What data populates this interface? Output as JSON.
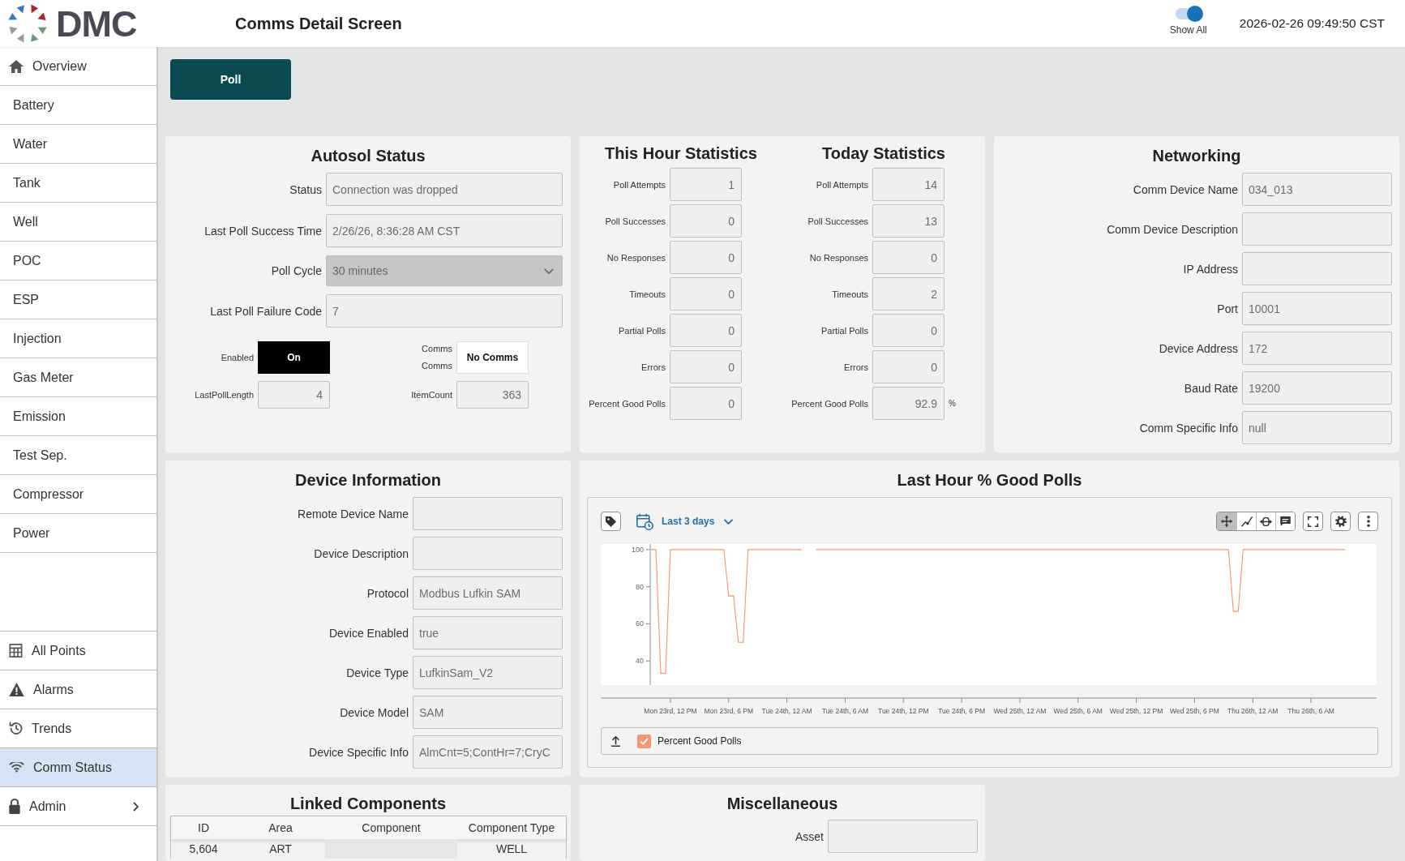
{
  "header": {
    "logo": "DMC",
    "title": "Comms Detail Screen",
    "show_all": {
      "label": "Show All",
      "on": true
    },
    "timestamp": "2026-02-26 09:49:50 CST"
  },
  "sidebar": {
    "items": [
      {
        "label": "Overview",
        "selected": false
      },
      {
        "label": "Battery",
        "selected": false
      },
      {
        "label": "Water",
        "selected": false
      },
      {
        "label": "Tank",
        "selected": false
      },
      {
        "label": "Well",
        "selected": false
      },
      {
        "label": "POC",
        "selected": false
      },
      {
        "label": "ESP",
        "selected": false
      },
      {
        "label": "Injection",
        "selected": false
      },
      {
        "label": "Gas Meter",
        "selected": false
      },
      {
        "label": "Emission",
        "selected": false
      },
      {
        "label": "Test Sep.",
        "selected": false
      },
      {
        "label": "Compressor",
        "selected": false
      },
      {
        "label": "Power",
        "selected": false
      }
    ],
    "bottom_items": [
      {
        "label": "All Points",
        "selected": false,
        "kind": "link"
      },
      {
        "label": "Alarms",
        "selected": false,
        "kind": "link"
      },
      {
        "label": "Trends",
        "selected": false,
        "kind": "link"
      },
      {
        "label": "Comm Status",
        "selected": true,
        "kind": "link"
      },
      {
        "label": "Admin",
        "selected": false,
        "kind": "group"
      }
    ]
  },
  "toolbar": {
    "poll_button": "Poll"
  },
  "autosol_status": {
    "title": "Autosol Status",
    "fields": [
      {
        "label": "Status",
        "value": "Connection was dropped",
        "kind": "text"
      },
      {
        "label": "Last Poll Success Time",
        "value": "2/26/26, 8:36:28 AM CST",
        "kind": "text"
      },
      {
        "label": "Poll Cycle",
        "value": "30 minutes",
        "kind": "select"
      },
      {
        "label": "Last Poll Failure Code",
        "value": "7",
        "kind": "text"
      }
    ],
    "indicators": [
      {
        "label": [
          "Enabled"
        ],
        "value": "On",
        "on": true
      },
      {
        "label": [
          "Comms",
          "Comms"
        ],
        "value": "No Comms",
        "on": false
      }
    ],
    "counters": [
      {
        "label": "LastPollLength",
        "value": "4"
      },
      {
        "label": "ItemCount",
        "value": "363"
      }
    ]
  },
  "statistics": [
    {
      "title": "This Hour Statistics",
      "rows": [
        {
          "label": "Poll Attempts",
          "value": "1"
        },
        {
          "label": "Poll Successes",
          "value": "0"
        },
        {
          "label": "No Responses",
          "value": "0"
        },
        {
          "label": "Timeouts",
          "value": "0"
        },
        {
          "label": "Partial Polls",
          "value": "0"
        },
        {
          "label": "Errors",
          "value": "0"
        },
        {
          "label": "Percent Good Polls",
          "value": "0"
        }
      ]
    },
    {
      "title": "Today Statistics",
      "rows": [
        {
          "label": "Poll Attempts",
          "value": "14"
        },
        {
          "label": "Poll Successes",
          "value": "13"
        },
        {
          "label": "No Responses",
          "value": "0"
        },
        {
          "label": "Timeouts",
          "value": "2"
        },
        {
          "label": "Partial Polls",
          "value": "0"
        },
        {
          "label": "Errors",
          "value": "0"
        },
        {
          "label": "Percent Good Polls",
          "value": "92.9",
          "unit": "%"
        }
      ]
    }
  ],
  "networking": {
    "title": "Networking",
    "fields": [
      {
        "label": "Comm Device Name",
        "value": "034_013"
      },
      {
        "label": "Comm Device Description"
      },
      {
        "label": "IP Address"
      },
      {
        "label": "Port",
        "value": "10001"
      },
      {
        "label": "Device Address",
        "value": "172"
      },
      {
        "label": "Baud Rate",
        "value": "19200"
      },
      {
        "label": "Comm Specific Info",
        "value": "null"
      }
    ]
  },
  "device_information": {
    "title": "Device Information",
    "fields": [
      {
        "label": "Remote Device Name"
      },
      {
        "label": "Device Description"
      },
      {
        "label": "Protocol",
        "value": "Modbus Lufkin SAM"
      },
      {
        "label": "Device Enabled",
        "value": "true"
      },
      {
        "label": "Device Type",
        "value": "LufkinSam_V2"
      },
      {
        "label": "Device Model",
        "value": "SAM"
      },
      {
        "label": "Device Specific Info",
        "value": "AlmCnt=5;ContHr=7;CryC"
      }
    ]
  },
  "chart_panel": {
    "title": "Last Hour % Good Polls",
    "range": "Last 3 days",
    "tools": [
      {
        "selected": true
      },
      {
        "selected": false
      },
      {
        "selected": false
      },
      {
        "selected": false
      }
    ],
    "legend": [
      {
        "checked": true
      }
    ],
    "chart_data": {
      "type": "line",
      "categories": [
        null,
        null,
        null,
        null,
        "Mon 23rd, 12 PM",
        null,
        null,
        null,
        null,
        null,
        null,
        null,
        null,
        null,
        null,
        null,
        "Mon 23rd, 6 PM",
        null,
        null,
        null,
        null,
        null,
        null,
        null,
        null,
        null,
        null,
        null,
        "Tue 24th, 12 AM",
        null,
        null,
        null,
        null,
        null,
        null,
        null,
        null,
        null,
        null,
        null,
        "Tue 24th, 6 AM",
        null,
        null,
        null,
        null,
        null,
        null,
        null,
        null,
        null,
        null,
        null,
        "Tue 24th, 12 PM",
        null,
        null,
        null,
        null,
        null,
        null,
        null,
        null,
        null,
        null,
        null,
        "Tue 24th, 6 PM",
        null,
        null,
        null,
        null,
        null,
        null,
        null,
        null,
        null,
        null,
        null,
        "Wed 25th, 12 AM",
        null,
        null,
        null,
        null,
        null,
        null,
        null,
        null,
        null,
        null,
        null,
        "Wed 25th, 6 AM",
        null,
        null,
        null,
        null,
        null,
        null,
        null,
        null,
        null,
        null,
        null,
        "Wed 25th, 12 PM",
        null,
        null,
        null,
        null,
        null,
        null,
        null,
        null,
        null,
        null,
        null,
        "Wed 25th, 6 PM",
        null,
        null,
        null,
        null,
        null,
        null,
        null,
        null,
        null,
        null,
        null,
        "Thu 26th, 12 AM",
        null,
        null,
        null,
        null,
        null,
        null,
        null,
        null,
        null,
        null,
        null,
        "Thu 26th, 6 AM",
        null,
        null,
        null,
        null,
        null,
        null,
        null
      ],
      "series": [
        {
          "name": "Percent Good Polls",
          "color": "#f7956c",
          "values": [
            100,
            100,
            33.3,
            33.3,
            100,
            100,
            100,
            100,
            100,
            100,
            100,
            100,
            100,
            100,
            100,
            100,
            75,
            75,
            50,
            50,
            100,
            100,
            100,
            100,
            100,
            100,
            100,
            100,
            100,
            100,
            100,
            100,
            null,
            null,
            100,
            100,
            100,
            100,
            100,
            100,
            100,
            100,
            100,
            100,
            100,
            100,
            100,
            100,
            100,
            100,
            100,
            100,
            100,
            100,
            100,
            100,
            100,
            100,
            100,
            100,
            100,
            100,
            100,
            100,
            100,
            100,
            100,
            100,
            100,
            100,
            100,
            100,
            100,
            100,
            100,
            100,
            100,
            100,
            100,
            100,
            100,
            100,
            100,
            100,
            100,
            100,
            100,
            100,
            100,
            100,
            100,
            100,
            100,
            100,
            100,
            100,
            100,
            100,
            100,
            100,
            100,
            100,
            100,
            100,
            100,
            100,
            100,
            100,
            100,
            100,
            100,
            100,
            100,
            100,
            100,
            100,
            100,
            100,
            100,
            100,
            66.7,
            66.7,
            100,
            100,
            100,
            100,
            100,
            100,
            100,
            100,
            100,
            100,
            100,
            100,
            100,
            100,
            100,
            100,
            100,
            100,
            100,
            100,
            100,
            100
          ]
        }
      ],
      "ylim": [
        27,
        103
      ],
      "yticks": [
        40,
        60,
        80,
        100
      ]
    }
  },
  "linked_components": {
    "title": "Linked Components",
    "columns": [
      "ID",
      "Area",
      "Component",
      "Component Type"
    ],
    "rows": [
      [
        "5,604",
        "ART",
        null,
        "WELL"
      ]
    ]
  },
  "miscellaneous": {
    "title": "Miscellaneous",
    "fields": [
      {
        "label": "Asset"
      }
    ]
  }
}
